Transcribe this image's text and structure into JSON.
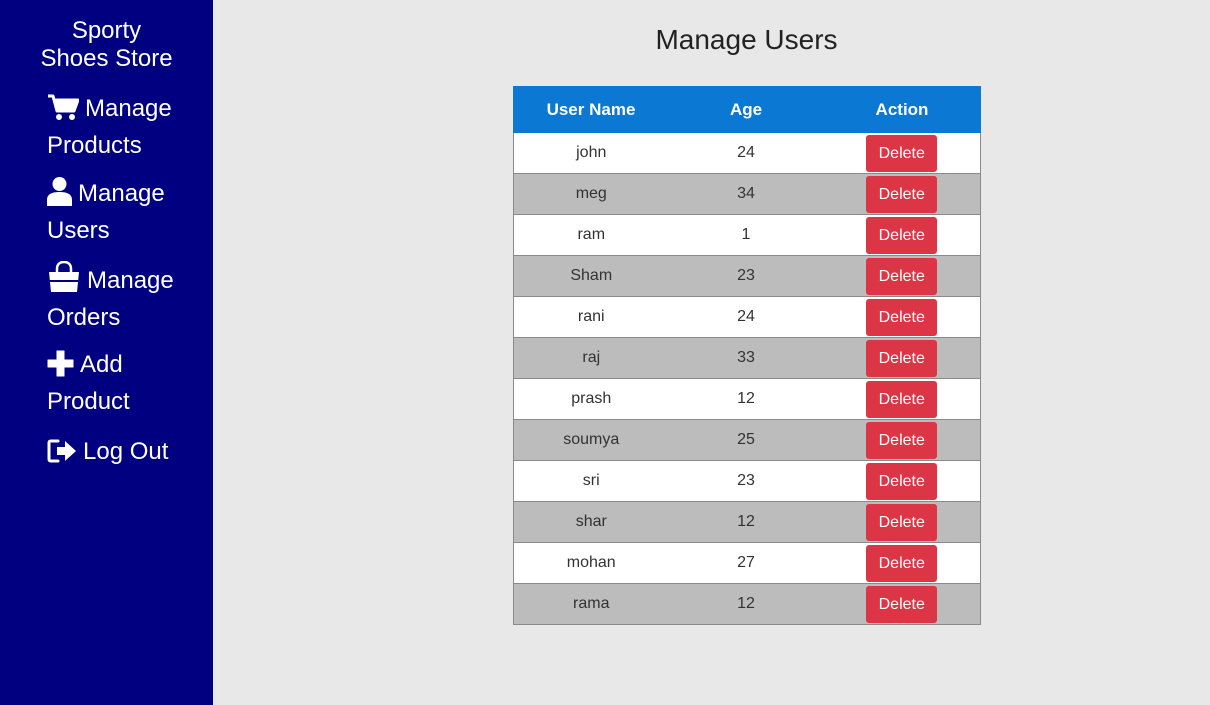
{
  "sidebar": {
    "brand_line1": "Sporty",
    "brand_line2": "Shoes Store",
    "items": [
      {
        "label_line1": "Manage",
        "label_line2": "Products",
        "icon": "cart-icon"
      },
      {
        "label_line1": "Manage",
        "label_line2": "Users",
        "icon": "user-icon"
      },
      {
        "label_line1": "Manage",
        "label_line2": "Orders",
        "icon": "shopping-bag-icon"
      },
      {
        "label_line1": "Add",
        "label_line2": "Product",
        "icon": "plus-icon"
      },
      {
        "label_line1": "Log Out",
        "label_line2": "",
        "icon": "logout-icon"
      }
    ]
  },
  "main": {
    "title": "Manage Users",
    "table": {
      "headers": [
        "User Name",
        "Age",
        "Action"
      ],
      "rows": [
        {
          "name": "john",
          "age": "24",
          "action": "Delete"
        },
        {
          "name": "meg",
          "age": "34",
          "action": "Delete"
        },
        {
          "name": "ram",
          "age": "1",
          "action": "Delete"
        },
        {
          "name": "Sham",
          "age": "23",
          "action": "Delete"
        },
        {
          "name": "rani",
          "age": "24",
          "action": "Delete"
        },
        {
          "name": "raj",
          "age": "33",
          "action": "Delete"
        },
        {
          "name": "prash",
          "age": "12",
          "action": "Delete"
        },
        {
          "name": "soumya",
          "age": "25",
          "action": "Delete"
        },
        {
          "name": "sri",
          "age": "23",
          "action": "Delete"
        },
        {
          "name": "shar",
          "age": "12",
          "action": "Delete"
        },
        {
          "name": "mohan",
          "age": "27",
          "action": "Delete"
        },
        {
          "name": "rama",
          "age": "12",
          "action": "Delete"
        }
      ]
    }
  },
  "colors": {
    "sidebar_bg": "#000080",
    "header_bg": "#0b78d4",
    "delete_button": "#dc3545",
    "row_alt": "#bcbcbc",
    "page_bg": "#e8e8e8"
  }
}
